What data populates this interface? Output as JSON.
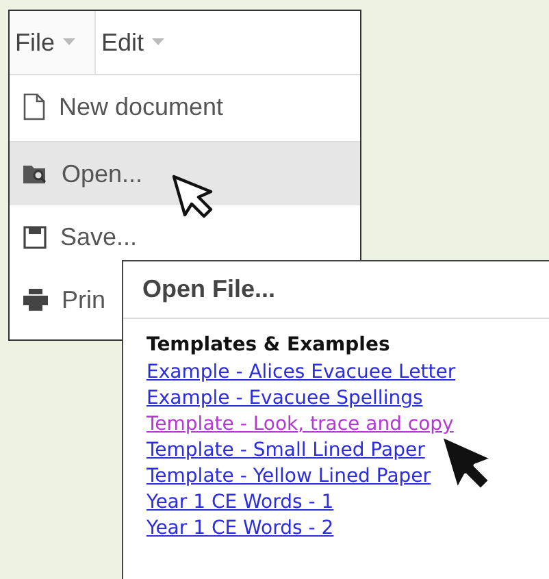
{
  "menubar": [
    {
      "label": "File",
      "selected": true
    },
    {
      "label": "Edit",
      "selected": false
    }
  ],
  "menu_items": [
    {
      "label": "New document",
      "kind": "new",
      "selected": false
    },
    {
      "label": "Open...",
      "kind": "open",
      "selected": true
    },
    {
      "label": "Save...",
      "kind": "save",
      "selected": false
    },
    {
      "label": "Prin",
      "kind": "print",
      "selected": false
    }
  ],
  "dialog": {
    "title": "Open File...",
    "section": "Templates & Examples",
    "links": [
      {
        "label": "Example - Alices Evacuee Letter",
        "visited": false
      },
      {
        "label": "Example - Evacuee Spellings",
        "visited": false
      },
      {
        "label": "Template - Look, trace and copy",
        "visited": true
      },
      {
        "label": "Template - Small Lined Paper",
        "visited": false
      },
      {
        "label": "Template - Yellow Lined Paper",
        "visited": false
      },
      {
        "label": "Year 1 CE Words - 1",
        "visited": false
      },
      {
        "label": "Year 1 CE Words - 2",
        "visited": false
      }
    ]
  }
}
